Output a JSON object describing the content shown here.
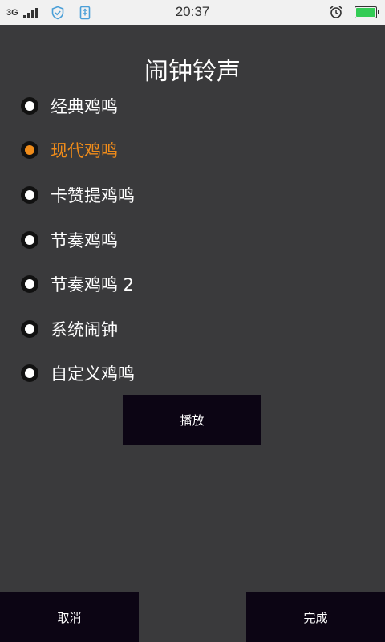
{
  "status_bar": {
    "network": "3G",
    "time": "20:37",
    "icons": [
      "signal-icon",
      "shield-icon",
      "usb-icon",
      "alarm-icon",
      "battery-icon"
    ],
    "battery_color": "#33cc55"
  },
  "dialog": {
    "title": "闹钟铃声",
    "ringtones": [
      {
        "label": "经典鸡鸣",
        "selected": false
      },
      {
        "label": "现代鸡鸣",
        "selected": true
      },
      {
        "label": "卡赞提鸡鸣",
        "selected": false
      },
      {
        "label": "节奏鸡鸣",
        "selected": false
      },
      {
        "label": "节奏鸡鸣 2",
        "selected": false
      },
      {
        "label": "系统闹钟",
        "selected": false
      },
      {
        "label": "自定义鸡鸣",
        "selected": false
      }
    ],
    "play_label": "播放",
    "cancel_label": "取消",
    "done_label": "完成",
    "accent_color": "#f08c1a"
  }
}
